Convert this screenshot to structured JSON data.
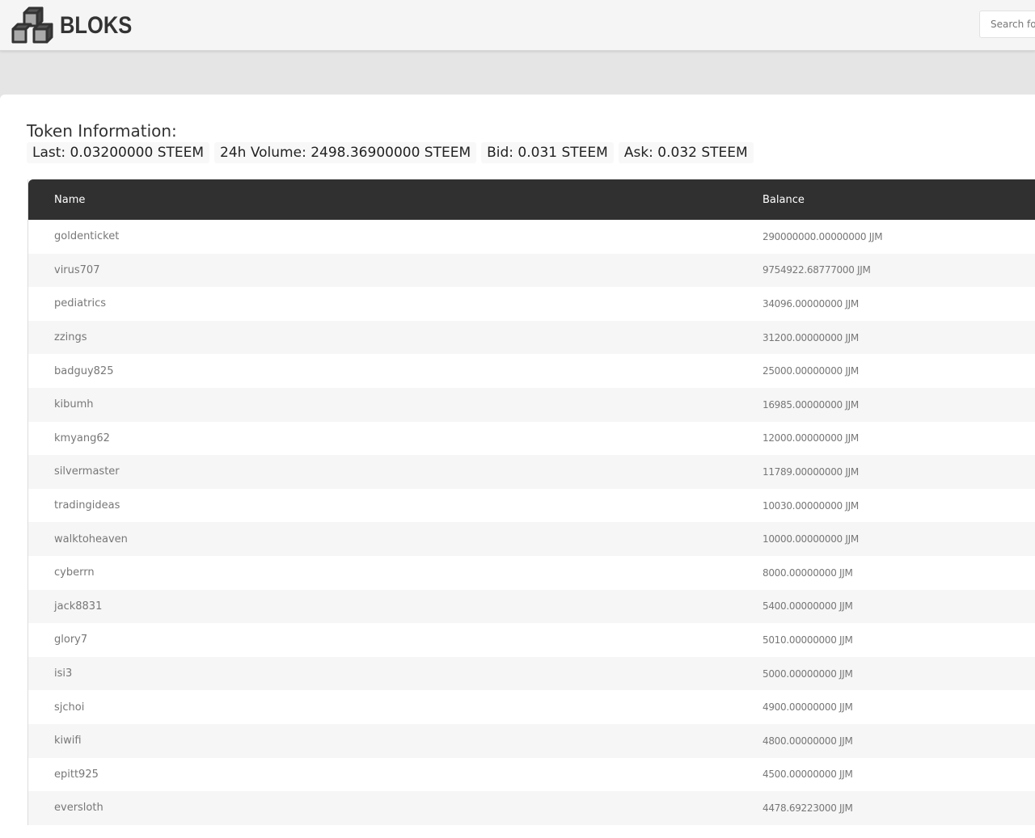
{
  "header": {
    "logo_text": "BLOKS",
    "search_placeholder": "Search for"
  },
  "token_info": {
    "title": "Token Information:",
    "last": "Last: 0.03200000 STEEM",
    "volume": "24h Volume: 2498.36900000 STEEM",
    "bid": "Bid: 0.031 STEEM",
    "ask": "Ask: 0.032 STEEM"
  },
  "table": {
    "columns": [
      "Name",
      "Balance"
    ],
    "rows": [
      [
        "goldenticket",
        "290000000.00000000 JJM"
      ],
      [
        "virus707",
        "9754922.68777000 JJM"
      ],
      [
        "pediatrics",
        "34096.00000000 JJM"
      ],
      [
        "zzings",
        "31200.00000000 JJM"
      ],
      [
        "badguy825",
        "25000.00000000 JJM"
      ],
      [
        "kibumh",
        "16985.00000000 JJM"
      ],
      [
        "kmyang62",
        "12000.00000000 JJM"
      ],
      [
        "silvermaster",
        "11789.00000000 JJM"
      ],
      [
        "tradingideas",
        "10030.00000000 JJM"
      ],
      [
        "walktoheaven",
        "10000.00000000 JJM"
      ],
      [
        "cyberrn",
        "8000.00000000 JJM"
      ],
      [
        "jack8831",
        "5400.00000000 JJM"
      ],
      [
        "glory7",
        "5010.00000000 JJM"
      ],
      [
        "isi3",
        "5000.00000000 JJM"
      ],
      [
        "sjchoi",
        "4900.00000000 JJM"
      ],
      [
        "kiwifi",
        "4800.00000000 JJM"
      ],
      [
        "epitt925",
        "4500.00000000 JJM"
      ],
      [
        "eversloth",
        "4478.69223000 JJM"
      ]
    ]
  }
}
